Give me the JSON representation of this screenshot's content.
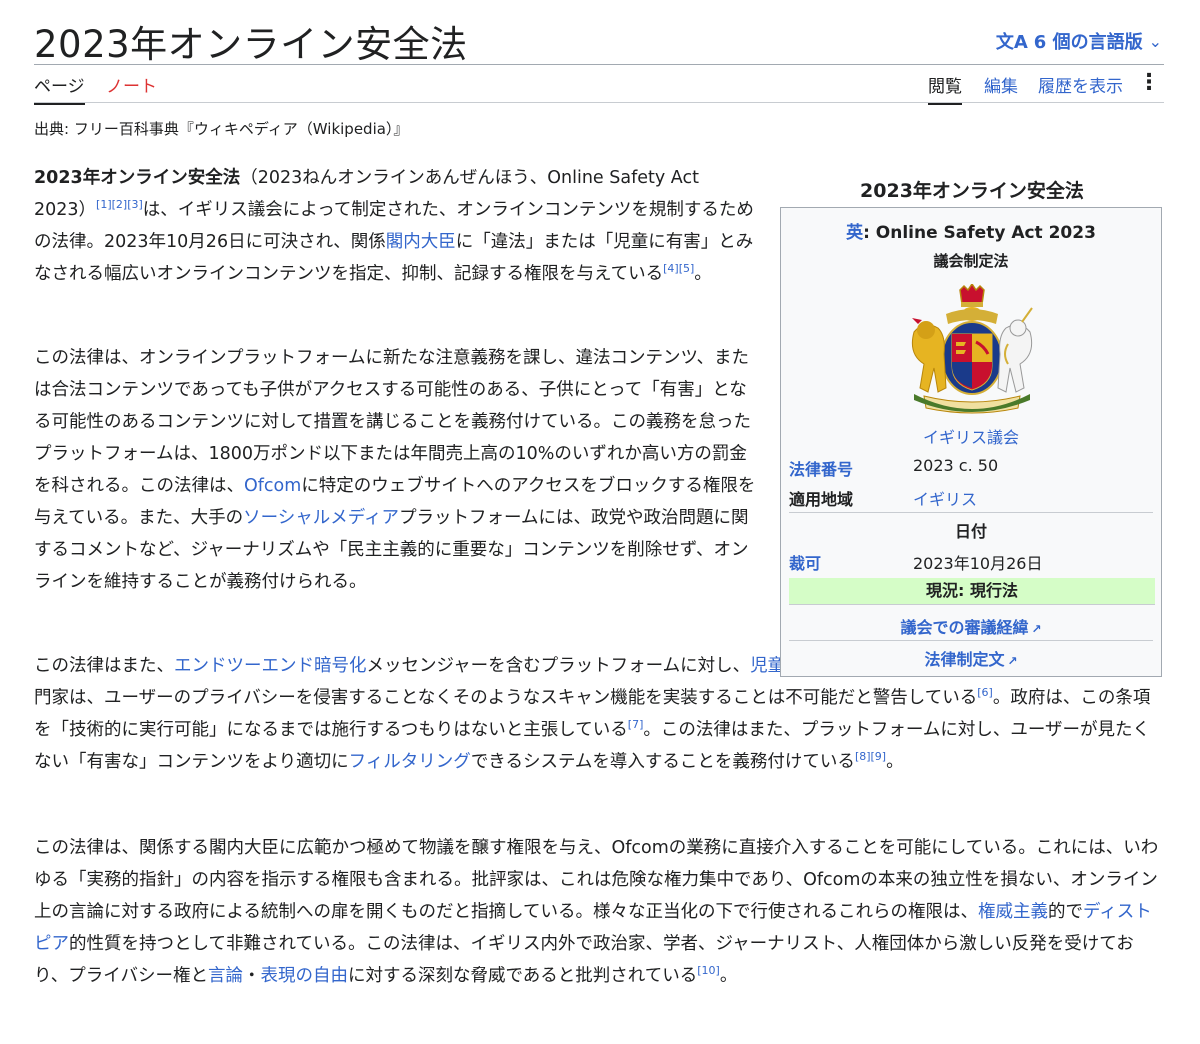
{
  "header": {
    "title": "2023年オンライン安全法",
    "lang_icon": "文A",
    "lang_label": "6 個の言語版",
    "lang_chevron": "⌄"
  },
  "tabs": {
    "page": "ページ",
    "talk": "ノート",
    "read": "閲覧",
    "edit": "編集",
    "history": "履歴を表示",
    "more": "⋮"
  },
  "source": "出典: フリー百科事典『ウィキペディア（Wikipedia）』",
  "p1": {
    "bold": "2023年オンライン安全法",
    "t1": "（2023ねんオンラインあんぜんほう、Online Safety Act 2023）",
    "ref1": "[1][2][3]",
    "t2": "は、イギリス議会によって制定された、オンラインコンテンツを規制するための法律。2023年10月26日に可決され、関係",
    "link1": "閣内大臣",
    "t3": "に「違法」または「児童に有害」とみなされる幅広いオンラインコンテンツを指定、抑制、記録する権限を与えている",
    "ref2": "[4][5]",
    "t4": "。"
  },
  "p2": {
    "t1": "この法律は、オンラインプラットフォームに新たな注意義務を課し、違法コンテンツ、または合法コンテンツであっても子供がアクセスする可能性のある、子供にとって「有害」となる可能性のあるコンテンツに対して措置を講じることを義務付けている。この義務を怠ったプラットフォームは、1800万ポンド以下または年間売上高の10%のいずれか高い方の罰金を科される。この法律は、",
    "link1": "Ofcom",
    "t2": "に特定のウェブサイトへのアクセスをブロックする権限を与えている。また、大手の",
    "link2": "ソーシャルメディア",
    "t3": "プラットフォームには、政党や政治問題に関するコメントなど、ジャーナリズムや「民主主義的に重要な」コンテンツを削除せず、オンラインを維持することが義務付けられる。"
  },
  "p3": {
    "t1": "この法律はまた、",
    "link1": "エンドツーエンド暗号化",
    "t2": "メッセンジャーを含むプラットフォームに対し、",
    "link2": "児童ポルノ",
    "t3": "のスキャン機能を義務付けているが、専門家は、ユーザーのプライバシーを侵害することなくそのようなスキャン機能を実装することは不可能だと警告している",
    "ref1": "[6]",
    "t4": "。政府は、この条項を「技術的に実行可能」になるまでは施行するつもりはないと主張している",
    "ref2": "[7]",
    "t5": "。この法律はまた、プラットフォームに対し、ユーザーが見たくない「有害な」コンテンツをより適切に",
    "link3": "フィルタリング",
    "t6": "できるシステムを導入することを義務付けている",
    "ref3": "[8][9]",
    "t7": "。"
  },
  "p4": {
    "t1": "この法律は、関係する閣内大臣に広範かつ極めて物議を醸す権限を与え、Ofcomの業務に直接介入することを可能にしている。これには、いわゆる「実務的指針」の内容を指示する権限も含まれる。批評家は、これは危険な権力集中であり、Ofcomの本来の独立性を損ない、オンライン上の言論に対する政府による統制への扉を開くものだと指摘している。様々な正当化の下で行使されるこれらの権限は、",
    "link1": "権威主義",
    "t2": "的で",
    "link2": "ディストピア",
    "t3": "的性質を持つとして非難されている。この法律は、イギリス内外で政治家、学者、ジャーナリスト、人権団体から激しい反発を受けており、プライバシー権と",
    "link3": "言論",
    "t4": "・",
    "link4": "表現の自由",
    "t5": "に対する深刻な脅威であると批判されている",
    "ref1": "[10]",
    "t6": "。"
  },
  "infobox": {
    "caption": "2023年オンライン安全法",
    "en_prefix": "英",
    "en_title": ": Online Safety Act 2023",
    "subtitle": "議会制定法",
    "parliament": "イギリス議会",
    "law_number_label": "法律番号",
    "law_number": "2023 c. 50",
    "territory_label": "適用地域",
    "territory": "イギリス",
    "dates_header": "日付",
    "assent_label": "裁可",
    "assent": "2023年10月26日",
    "status": "現況: 現行法",
    "link_hansard": "議会での審議経緯",
    "link_text": "法律制定文",
    "ext_icon": "↗"
  }
}
